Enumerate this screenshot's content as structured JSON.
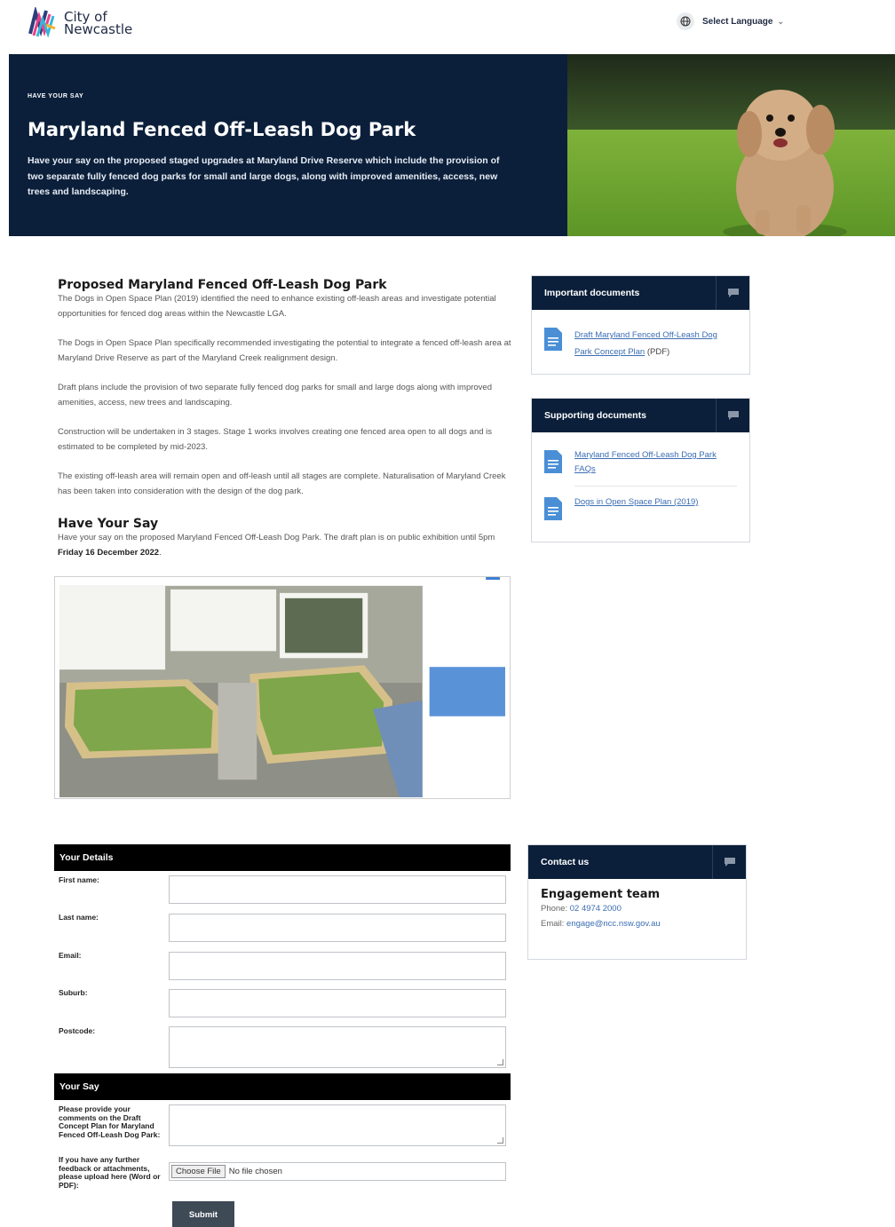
{
  "header": {
    "logo_line1": "City of",
    "logo_line2": "Newcastle",
    "language_label": "Select Language"
  },
  "hero": {
    "kicker": "HAVE YOUR SAY",
    "title": "Maryland Fenced Off-Leash Dog Park",
    "description": "Have your say on the proposed staged upgrades at Maryland Drive Reserve which include the provision of two separate fully fenced dog parks for small and large dogs, along with improved amenities, access, new trees and landscaping."
  },
  "main": {
    "heading": "Proposed Maryland Fenced Off-Leash Dog Park",
    "paragraphs": [
      "The Dogs in Open Space Plan (2019) identified the need to enhance existing off-leash areas and investigate potential opportunities for fenced dog areas within the Newcastle LGA.",
      "The Dogs in Open Space Plan specifically recommended investigating the potential to integrate a fenced off-leash area at Maryland Drive Reserve as part of the Maryland Creek realignment design.",
      "Draft plans include the provision of two separate fully fenced dog parks for small and large dogs along with improved amenities, access, new trees and landscaping.",
      "Construction will be undertaken in 3 stages. Stage 1 works involves creating one fenced area open to all dogs and is estimated to be completed by mid-2023.",
      "The existing off-leash area will remain open and off-leash until all stages are complete. Naturalisation of Maryland Creek has been taken into consideration with the design of the dog park."
    ],
    "have_your_say_heading": "Have Your Say",
    "have_your_say_text": "Have your say on the proposed Maryland Fenced Off-Leash Dog Park. The draft plan is on public exhibition until 5pm",
    "have_your_say_date": "Friday 16 December 2022",
    "have_your_say_end": "."
  },
  "important_docs": {
    "title": "Important documents",
    "items": [
      {
        "label": "Draft Maryland Fenced Off-Leash Dog Park Concept Plan",
        "suffix": " (PDF)"
      }
    ]
  },
  "supporting_docs": {
    "title": "Supporting documents",
    "items": [
      {
        "label": "Maryland Fenced Off-Leash Dog Park FAQs"
      },
      {
        "label": "Dogs in Open Space Plan (2019)"
      }
    ]
  },
  "contact": {
    "title": "Contact us",
    "name": "Engagement team",
    "phone_label": "Phone: ",
    "phone": "02 4974 2000",
    "email_label": "Email: ",
    "email": "engage@ncc.nsw.gov.au"
  },
  "form": {
    "details_title": "Your Details",
    "first_name_label": "First name:",
    "last_name_label": "Last name:",
    "email_label": "Email:",
    "suburb_label": "Suburb:",
    "postcode_label": "Postcode:",
    "say_title": "Your Say",
    "comments_label": "Please provide your comments on the Draft Concept Plan for Maryland Fenced Off-Leash Dog Park:",
    "upload_label": "If you have any further feedback or attachments, please upload here (Word or PDF):",
    "choose_file": "Choose File",
    "no_file": "No file chosen",
    "submit": "Submit"
  },
  "colors": {
    "navy": "#0b1f3a",
    "link": "#3b6db3",
    "form_bar": "#000000",
    "submit": "#3e4a56"
  }
}
